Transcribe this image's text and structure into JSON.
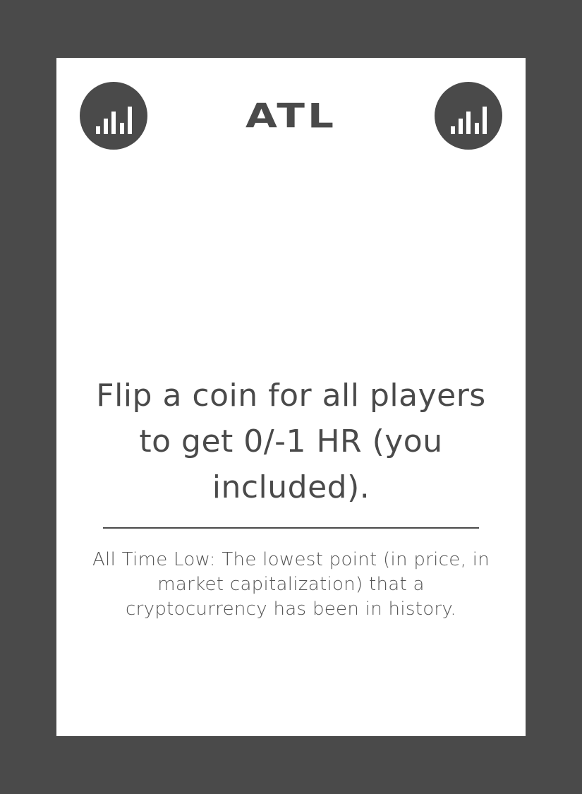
{
  "card": {
    "title": "ATL",
    "left_icon": "signal-bars-icon",
    "right_icon": "signal-bars-icon",
    "effect_text": "Flip a coin for all players to get 0/-1 HR (you included).",
    "definition_text": "All Time Low: The lowest point (in price, in market capitalization) that a cryptocurrency has been in history."
  },
  "colors": {
    "frame": "#4a4a4a",
    "card_background": "#ffffff",
    "ink": "#4a4a4a"
  }
}
